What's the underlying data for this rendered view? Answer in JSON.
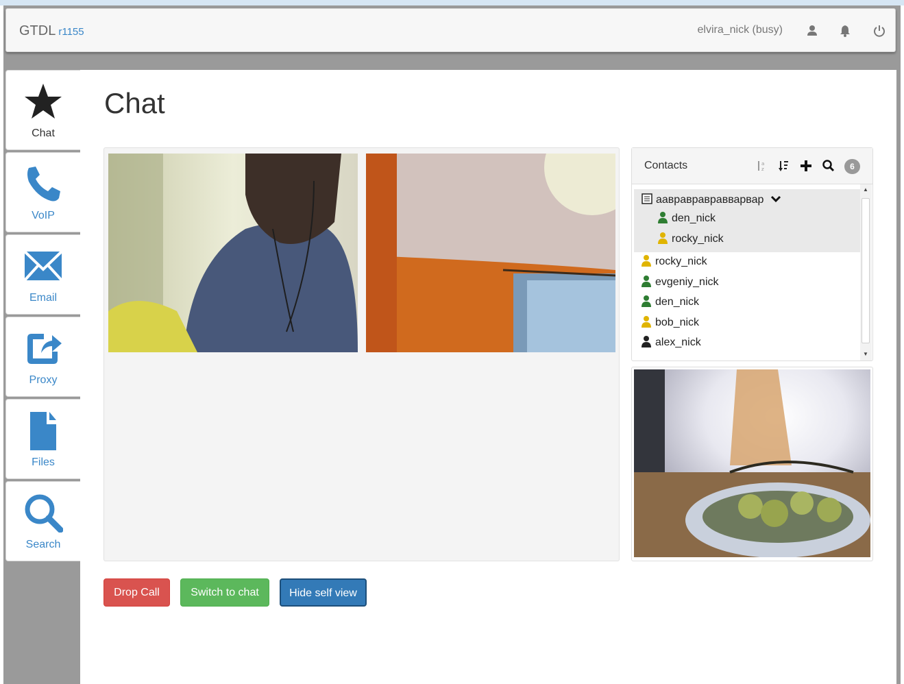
{
  "navbar": {
    "brand": "GTDL",
    "version": "r1155",
    "user_status": "elvira_nick (busy)",
    "icons": [
      "user-icon",
      "bell-icon",
      "power-icon"
    ]
  },
  "sidebar": {
    "items": [
      {
        "label": "Chat",
        "icon": "star-icon",
        "active": true
      },
      {
        "label": "VoIP",
        "icon": "phone-icon"
      },
      {
        "label": "Email",
        "icon": "envelope-icon"
      },
      {
        "label": "Proxy",
        "icon": "share-icon"
      },
      {
        "label": "Files",
        "icon": "file-icon"
      },
      {
        "label": "Search",
        "icon": "search-icon"
      }
    ]
  },
  "page": {
    "title": "Chat"
  },
  "contacts": {
    "title": "Contacts",
    "count": "6",
    "tool_icons": [
      "sort-alpha-icon",
      "sort-status-icon",
      "plus-icon",
      "search-icon"
    ],
    "group": {
      "name": "аавравравравварвар",
      "members": [
        {
          "name": "den_nick",
          "status": "green"
        },
        {
          "name": "rocky_nick",
          "status": "yellow"
        }
      ]
    },
    "list": [
      {
        "name": "rocky_nick",
        "status": "yellow"
      },
      {
        "name": "evgeniy_nick",
        "status": "green"
      },
      {
        "name": "den_nick",
        "status": "green"
      },
      {
        "name": "bob_nick",
        "status": "yellow"
      },
      {
        "name": "alex_nick",
        "status": "black"
      }
    ]
  },
  "colors": {
    "green": "#2e7d32",
    "yellow": "#e0b400",
    "black": "#222222",
    "accent": "#3a87c8"
  },
  "buttons": {
    "drop_call": "Drop Call",
    "switch_to_chat": "Switch to chat",
    "hide_self_view": "Hide self view"
  }
}
